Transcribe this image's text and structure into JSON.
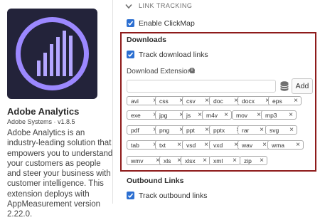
{
  "extension": {
    "name": "Adobe Analytics",
    "vendor": "Adobe Systems · v1.8.5",
    "description": "Adobe Analytics is an industry-leading solution that empowers you to understand your customers as people and steer your business with customer intelligence. This extension deploys with AppMeasurement version 2.22.0.",
    "logo_icon": "adobe-analytics-logo"
  },
  "link_tracking": {
    "heading": "LINK TRACKING",
    "clickmap_label": "Enable ClickMap",
    "clickmap_checked": true
  },
  "downloads": {
    "heading": "Downloads",
    "track_label": "Track download links",
    "track_checked": true,
    "extensions_label": "Download Extensions",
    "input_value": "",
    "input_placeholder": "",
    "add_label": "Add",
    "tags": [
      "avi",
      "css",
      "csv",
      "doc",
      "docx",
      "eps",
      "exe",
      "jpg",
      "js",
      "m4v",
      "mov",
      "mp3",
      "pdf",
      "png",
      "ppt",
      "pptx",
      "rar",
      "svg",
      "tab",
      "txt",
      "vsd",
      "vxd",
      "wav",
      "wma",
      "wmv",
      "xls",
      "xlsx",
      "xml",
      "zip"
    ]
  },
  "outbound": {
    "heading": "Outbound Links",
    "track_label": "Track outbound links",
    "track_checked": true
  },
  "colors": {
    "accent": "#2c6fd1",
    "highlight_border": "#8e1b1b",
    "logo_bg": "#23233a",
    "logo_ring": "#9c88ff"
  }
}
